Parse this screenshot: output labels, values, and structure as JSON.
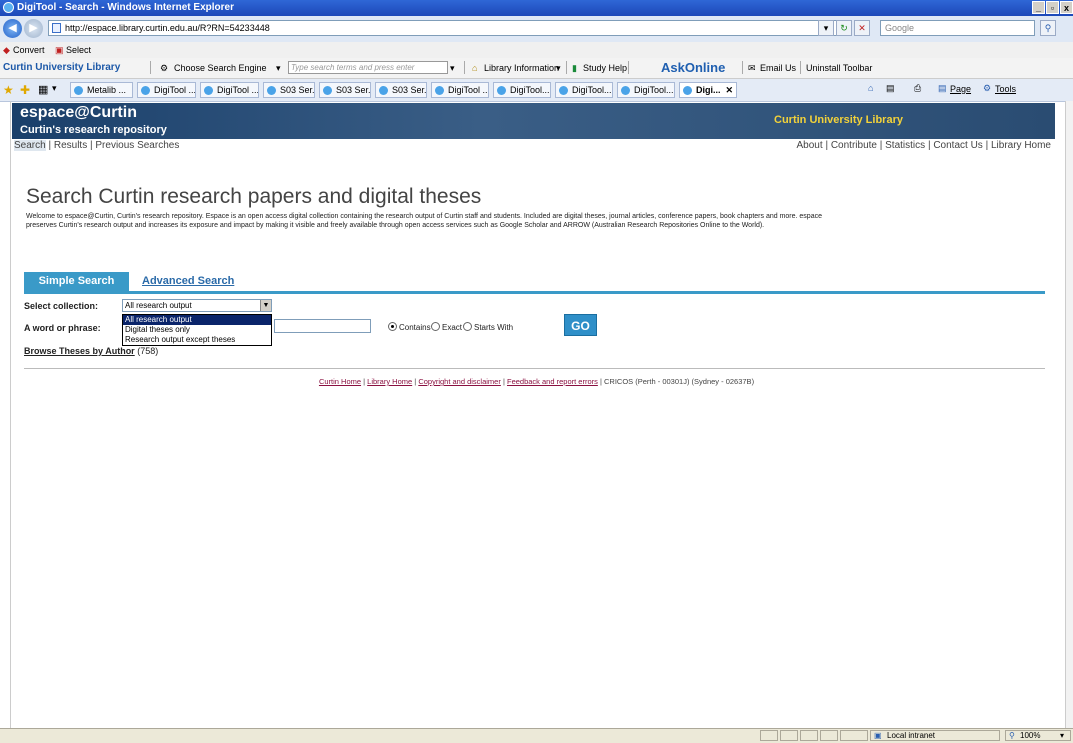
{
  "window": {
    "title": "DigiTool - Search - Windows Internet Explorer",
    "min_label": "_",
    "max_label": "▫",
    "close_label": "x"
  },
  "addressbar": {
    "url": "http://espace.library.curtin.edu.au/R?RN=54233448",
    "search_placeholder": "Google"
  },
  "convert_bar": {
    "convert_label": "Convert",
    "select_label": "Select"
  },
  "curtin_toolbar": {
    "name": "Curtin University Library",
    "engine_label": "Choose Search Engine",
    "search_placeholder": "Type search terms and press enter",
    "library_info": "Library Information",
    "study_help": "Study Help",
    "ask_online": "AskOnline",
    "email_us": "Email Us",
    "uninstall": "Uninstall Toolbar"
  },
  "browser_tabs": [
    {
      "label": "Metalib ..."
    },
    {
      "label": "DigiTool ..."
    },
    {
      "label": "DigiTool ..."
    },
    {
      "label": "S03 Ser..."
    },
    {
      "label": "S03 Ser..."
    },
    {
      "label": "S03 Ser..."
    },
    {
      "label": "DigiTool ..."
    },
    {
      "label": "DigiTool..."
    },
    {
      "label": "DigiTool..."
    },
    {
      "label": "DigiTool..."
    },
    {
      "label": "Digi..."
    }
  ],
  "browser_tools": {
    "page_label": "Page",
    "tools_label": "Tools"
  },
  "banner": {
    "site_name": "espace@Curtin",
    "tagline": "Curtin's research repository",
    "library": "Curtin University Library"
  },
  "page_nav": {
    "left": [
      "Search",
      "Results",
      "Previous Searches"
    ],
    "right": [
      "About",
      "Contribute",
      "Statistics",
      "Contact Us",
      "Library Home"
    ]
  },
  "main": {
    "title": "Search Curtin research papers and digital theses",
    "intro": "Welcome to espace@Curtin, Curtin's research repository. Espace is an open access digital collection containing the research output of Curtin staff and students. Included are digital theses, journal articles, conference papers, book chapters and more. espace preserves Curtin's research output and increases its exposure and impact by making it visible and freely available through open access services such as Google Scholar and ARROW (Australian Research Repositories Online to the World)."
  },
  "search": {
    "tab_simple": "Simple Search",
    "tab_advanced": "Advanced Search",
    "collection_label": "Select collection:",
    "collection_value": "All research output",
    "collection_options": [
      "All research output",
      "Digital theses only",
      "Research output except theses"
    ],
    "phrase_label": "A word or phrase:",
    "phrase_value": "",
    "radio_contains": "Contains",
    "radio_exact": "Exact",
    "radio_starts": "Starts With",
    "go": "GO"
  },
  "browse": {
    "link": "Browse Theses by Author",
    "count": "(758)"
  },
  "footer": {
    "links": [
      "Curtin Home",
      "Library Home",
      "Copyright and disclaimer",
      "Feedback and report errors"
    ],
    "cricos": "CRICOS (Perth - 00301J) (Sydney - 02637B)"
  },
  "statusbar": {
    "zone": "Local intranet",
    "zoom": "100%"
  }
}
